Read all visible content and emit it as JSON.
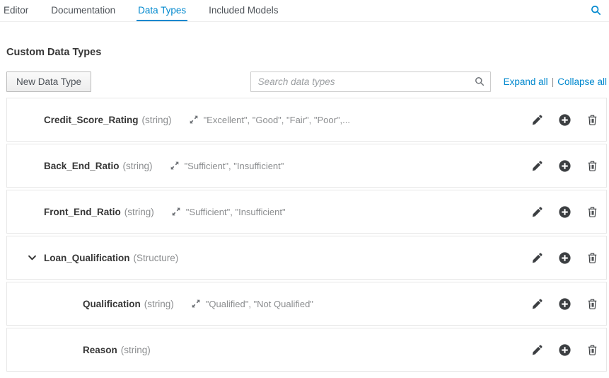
{
  "header": {
    "tabs": [
      {
        "label": "Editor",
        "active": false
      },
      {
        "label": "Documentation",
        "active": false
      },
      {
        "label": "Data Types",
        "active": true
      },
      {
        "label": "Included Models",
        "active": false
      }
    ],
    "search_icon": "magnifier"
  },
  "section": {
    "title": "Custom Data Types"
  },
  "toolbar": {
    "new_data_type_button": "New Data Type",
    "search_placeholder": "Search data types",
    "expand_all_link": "Expand all",
    "link_separator": "|",
    "collapse_all_link": "Collapse all"
  },
  "data_types": [
    {
      "name": "Credit_Score_Rating",
      "type": "(string)",
      "constraint": "\"Excellent\", \"Good\", \"Fair\", \"Poor\",...",
      "level": 0,
      "expanded": false
    },
    {
      "name": "Back_End_Ratio",
      "type": "(string)",
      "constraint": "\"Sufficient\", \"Insufficient\"",
      "level": 0,
      "expanded": false
    },
    {
      "name": "Front_End_Ratio",
      "type": "(string)",
      "constraint": "\"Sufficient\", \"Insufficient\"",
      "level": 0,
      "expanded": false
    },
    {
      "name": "Loan_Qualification",
      "type": "(Structure)",
      "constraint": null,
      "level": 0,
      "expanded": true
    },
    {
      "name": "Qualification",
      "type": "(string)",
      "constraint": "\"Qualified\", \"Not Qualified\"",
      "level": 1,
      "expanded": false
    },
    {
      "name": "Reason",
      "type": "(string)",
      "constraint": null,
      "level": 1,
      "expanded": false
    }
  ],
  "row_action_icons": [
    {
      "icon": "pencil-icon",
      "meaning": "edit"
    },
    {
      "icon": "plus-circle-icon",
      "meaning": "add nested data type"
    },
    {
      "icon": "trash-icon",
      "meaning": "delete"
    }
  ],
  "icons": {
    "magnifier": "search",
    "chevron-down": "expanded structure",
    "constraint-arrows": "constraint values"
  },
  "colors": {
    "accent_blue": "#0088ce",
    "tab_text": "#4d5258",
    "heading_text": "#363636",
    "muted_text": "#8b8d8f",
    "icon_dark": "#3c3f42",
    "row_border": "#e7e7e7",
    "input_border": "#cccccc"
  }
}
